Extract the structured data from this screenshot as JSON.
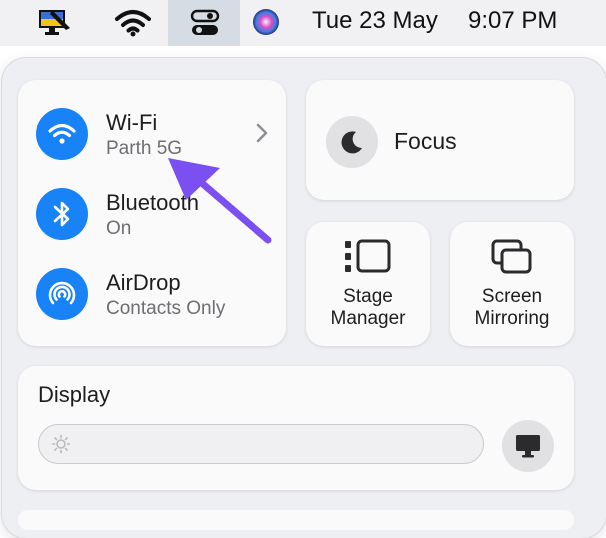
{
  "menubar": {
    "date": "Tue 23 May",
    "time": "9:07 PM",
    "icons": [
      "flag-monitor-icon",
      "wifi-icon",
      "control-center-icon",
      "siri-icon"
    ]
  },
  "connectivity": {
    "wifi": {
      "title": "Wi-Fi",
      "subtitle": "Parth 5G",
      "icon": "wifi-icon"
    },
    "bluetooth": {
      "title": "Bluetooth",
      "subtitle": "On",
      "icon": "bluetooth-icon"
    },
    "airdrop": {
      "title": "AirDrop",
      "subtitle": "Contacts Only",
      "icon": "airdrop-icon"
    }
  },
  "focus": {
    "label": "Focus",
    "icon": "moon-icon"
  },
  "stage_manager": {
    "line1": "Stage",
    "line2": "Manager",
    "icon": "stage-manager-icon"
  },
  "screen_mirroring": {
    "line1": "Screen",
    "line2": "Mirroring",
    "icon": "screen-mirroring-icon"
  },
  "display": {
    "label": "Display",
    "icon": "display-icon",
    "brightness_icon": "sun-icon"
  },
  "annotation": {
    "type": "arrow",
    "color": "#7b4ff0",
    "points_to": "wifi-subtitle"
  },
  "colors": {
    "accent": "#1783f6",
    "arrow": "#7b4ff0"
  }
}
